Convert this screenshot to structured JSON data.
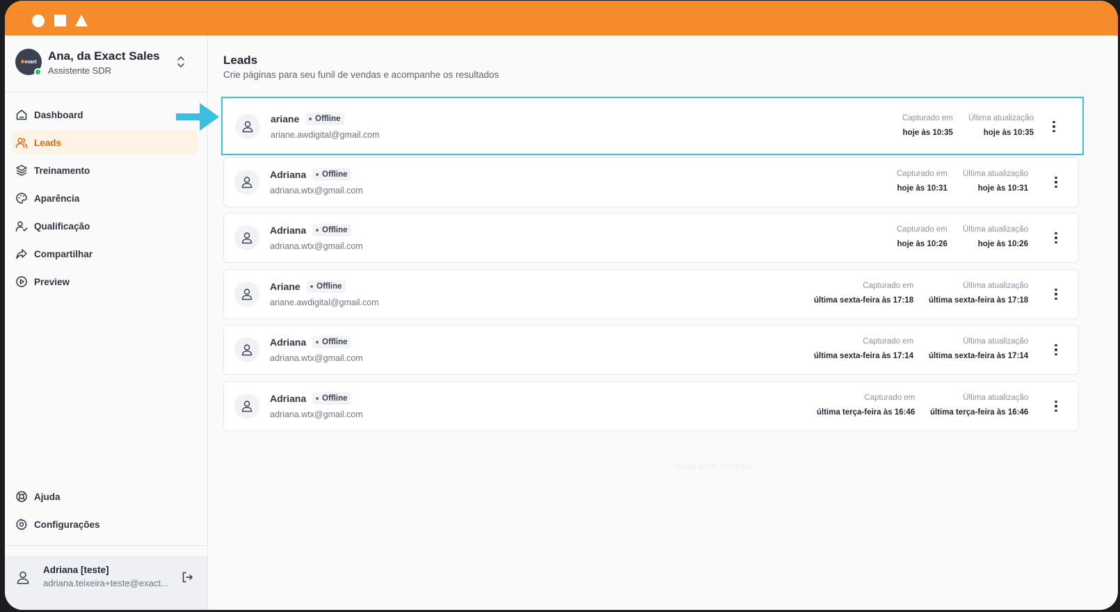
{
  "agent": {
    "name": "Ana, da Exact Sales",
    "role": "Assistente SDR",
    "logo_text": "exact"
  },
  "nav": {
    "items": [
      {
        "label": "Dashboard",
        "icon": "home-icon"
      },
      {
        "label": "Leads",
        "icon": "users-icon",
        "active": true
      },
      {
        "label": "Treinamento",
        "icon": "layers-icon"
      },
      {
        "label": "Aparência",
        "icon": "palette-icon"
      },
      {
        "label": "Qualificação",
        "icon": "user-check-icon"
      },
      {
        "label": "Compartilhar",
        "icon": "share-icon"
      },
      {
        "label": "Preview",
        "icon": "play-circle-icon"
      }
    ],
    "bottom": [
      {
        "label": "Ajuda",
        "icon": "lifebuoy-icon"
      },
      {
        "label": "Configurações",
        "icon": "gear-icon"
      }
    ]
  },
  "user": {
    "name": "Adriana [teste]",
    "email": "adriana.teixeira+teste@exact..."
  },
  "page": {
    "title": "Leads",
    "subtitle": "Crie páginas para seu funil de vendas e acompanhe os resultados"
  },
  "labels": {
    "captured": "Capturado em",
    "updated": "Última atualização"
  },
  "leads": [
    {
      "name": "ariane",
      "status": "Offline",
      "email": "ariane.awdigital@gmail.com",
      "captured": "hoje às 10:35",
      "updated": "hoje às 10:35"
    },
    {
      "name": "Adriana",
      "status": "Offline",
      "email": "adriana.wtx@gmail.com",
      "captured": "hoje às 10:31",
      "updated": "hoje às 10:31"
    },
    {
      "name": "Adriana",
      "status": "Offline",
      "email": "adriana.wtx@gmail.com",
      "captured": "hoje às 10:26",
      "updated": "hoje às 10:26"
    },
    {
      "name": "Ariane",
      "status": "Offline",
      "email": "ariane.awdigital@gmail.com",
      "captured": "última sexta-feira às 17:18",
      "updated": "última sexta-feira às 17:18"
    },
    {
      "name": "Adriana",
      "status": "Offline",
      "email": "adriana.wtx@gmail.com",
      "captured": "última sexta-feira às 17:14",
      "updated": "última sexta-feira às 17:14"
    },
    {
      "name": "Adriana",
      "status": "Offline",
      "email": "adriana.wtx@gmail.com",
      "captured": "última terça-feira às 16:46",
      "updated": "última terça-feira às 16:46"
    }
  ],
  "footer_text": "Nada para carregar",
  "colors": {
    "titlebar": "#f68b2b",
    "active_bg": "#fff3e6",
    "active_text": "#d66a10",
    "highlight": "#3bbfe0",
    "online": "#22c55e"
  }
}
